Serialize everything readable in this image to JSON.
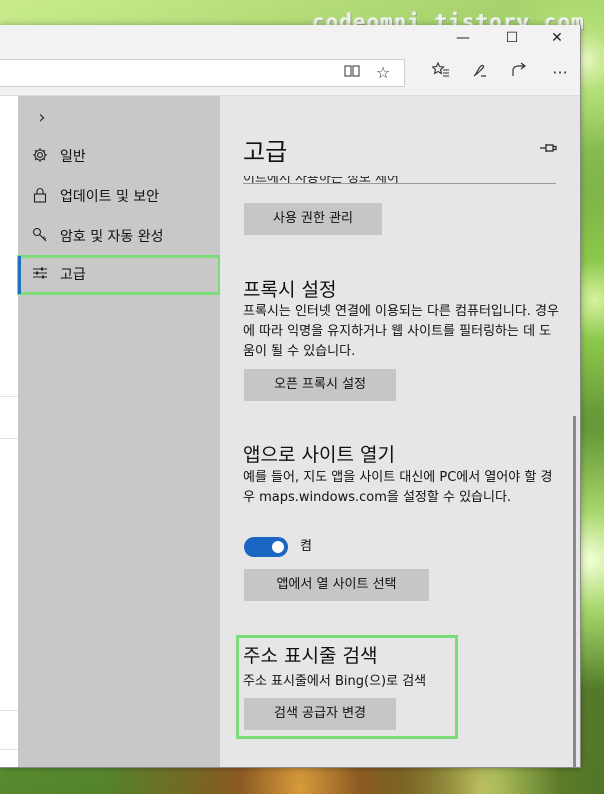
{
  "watermark": "codeomni.tistory.com",
  "window": {
    "minimize_glyph": "—",
    "maximize_glyph": "☐",
    "close_glyph": "✕"
  },
  "toolbar": {
    "icons": [
      "reading-view-icon",
      "favorite-star-icon",
      "favorites-hub-icon",
      "web-note-icon",
      "share-icon",
      "more-icon"
    ]
  },
  "nav": {
    "collapse_glyph": "›",
    "items": [
      {
        "label": "일반",
        "icon": "gear-icon"
      },
      {
        "label": "업데이트 및 보안",
        "icon": "lock-icon"
      },
      {
        "label": "암호 및 자동 완성",
        "icon": "key-icon"
      },
      {
        "label": "고급",
        "icon": "sliders-icon"
      }
    ]
  },
  "panel": {
    "title": "고급",
    "clipped_text": "이트에서 사용하는 정보 제어",
    "permissions_button": "사용 권한 관리",
    "proxy": {
      "title": "프록시 설정",
      "desc": "프록시는 인터넷 연결에 이용되는 다른 컴퓨터입니다. 경우에 따라 익명을 유지하거나 웹 사이트를 필터링하는 데 도움이 될 수 있습니다.",
      "button": "오픈 프록시 설정"
    },
    "apps": {
      "title": "앱으로 사이트 열기",
      "desc": "예를 들어, 지도 앱을 사이트 대신에 PC에서 열어야 할 경우 maps.windows.com을 설정할 수 있습니다.",
      "toggle_label": "켬",
      "toggle_on": true,
      "button": "앱에서 열 사이트 선택"
    },
    "search": {
      "title": "주소 표시줄 검색",
      "desc": "주소 표시줄에서 Bing(으)로 검색",
      "button": "검색 공급자 변경"
    }
  },
  "colors": {
    "accent": "#1a64c2",
    "highlight": "#7ddc7a",
    "nav_bg": "#c8c8c8",
    "panel_bg": "#e6e6e6"
  }
}
